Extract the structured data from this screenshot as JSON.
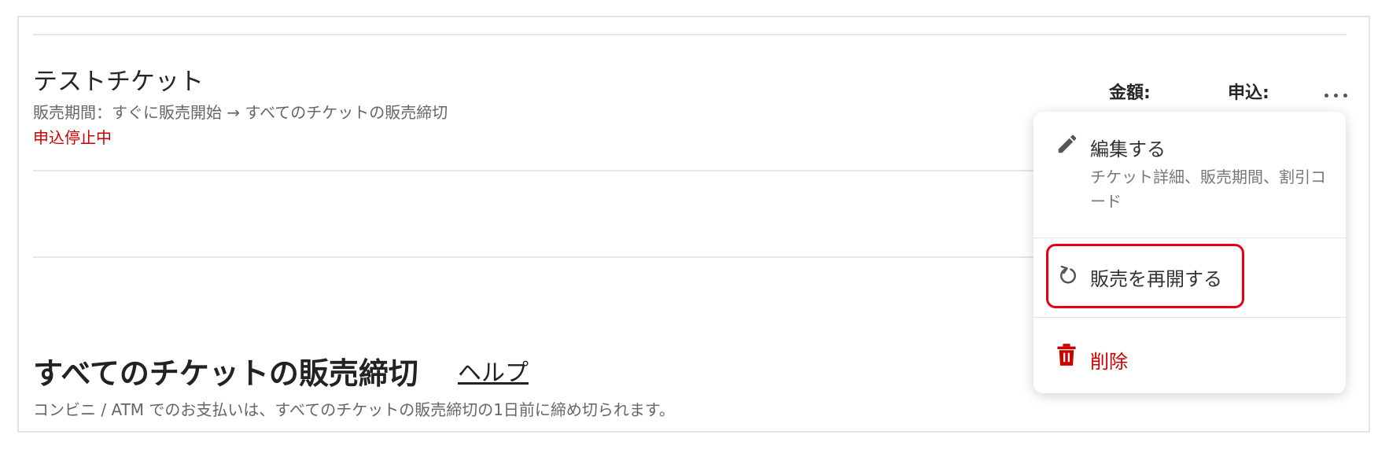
{
  "ticket": {
    "name": "テストチケット",
    "period": "販売期間：すぐに販売開始 → すべてのチケットの販売締切",
    "status": "申込停止中",
    "columns": {
      "amount": "金額:",
      "applications": "申込:"
    }
  },
  "section": {
    "title": "すべてのチケットの販売締切",
    "help_link": "ヘルプ",
    "description": "コンビニ / ATM でのお支払いは、すべてのチケットの販売締切の1日前に締め切られます。"
  },
  "menu": {
    "items": [
      {
        "label": "編集する",
        "description": "チケット詳細、販売期間、割引コード",
        "icon": "pencil-icon"
      },
      {
        "label": "販売を再開する",
        "icon": "refresh-icon"
      },
      {
        "label": "削除",
        "icon": "trash-icon"
      }
    ]
  },
  "colors": {
    "danger": "#cc0000",
    "highlight": "#e60012",
    "text": "#333333"
  }
}
